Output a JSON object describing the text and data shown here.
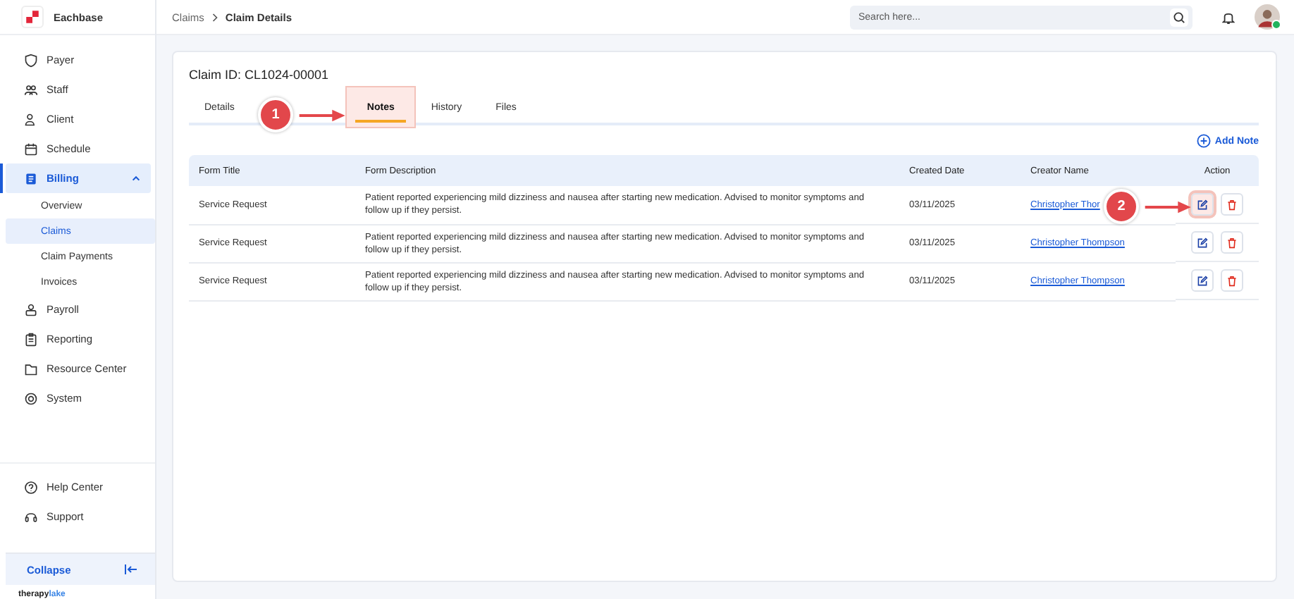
{
  "brand": {
    "name": "Eachbase"
  },
  "sidebar": {
    "items": [
      {
        "label": "Payer",
        "selected": false
      },
      {
        "label": "Staff",
        "selected": false
      },
      {
        "label": "Client",
        "selected": false
      },
      {
        "label": "Schedule",
        "selected": false
      },
      {
        "label": "Billing",
        "selected": true,
        "expanded": true,
        "children": [
          {
            "label": "Overview",
            "selected": false
          },
          {
            "label": "Claims",
            "selected": true
          },
          {
            "label": "Claim Payments",
            "selected": false
          },
          {
            "label": "Invoices",
            "selected": false
          }
        ]
      },
      {
        "label": "Payroll",
        "selected": false
      },
      {
        "label": "Reporting",
        "selected": false
      },
      {
        "label": "Resource Center",
        "selected": false
      },
      {
        "label": "System",
        "selected": false
      }
    ],
    "bottom_items": [
      {
        "label": "Help Center"
      },
      {
        "label": "Support"
      }
    ],
    "collapse": {
      "label": "Collapse"
    },
    "footer_logo": {
      "text": "therapy",
      "accent": "lake"
    }
  },
  "breadcrumb": [
    "Claims",
    "Claim Details"
  ],
  "search": {
    "placeholder": "Search here..."
  },
  "user": {
    "online": true
  },
  "claim": {
    "title": "Claim ID: CL1024-00001"
  },
  "tabs": [
    {
      "label": "Details",
      "selected": false,
      "highlighted": false
    },
    {
      "label": "Notes",
      "selected": true,
      "highlighted": true
    },
    {
      "label": "History",
      "selected": false,
      "highlighted": false
    },
    {
      "label": "Files",
      "selected": false,
      "highlighted": false
    }
  ],
  "add_note": {
    "label": "Add Note"
  },
  "table": {
    "columns": [
      "Form Title",
      "Form Description",
      "Created Date",
      "Creator Name",
      "Action"
    ],
    "rows": [
      {
        "title": "Service Request",
        "description": "Patient reported experiencing mild dizziness and nausea after starting new medication. Advised to monitor symptoms and follow up if they persist.",
        "date": "03/11/2025",
        "creator": "Christopher Thor",
        "edit_highlighted": true
      },
      {
        "title": "Service Request",
        "description": "Patient reported experiencing mild dizziness and nausea after starting new medication. Advised to monitor symptoms and follow up if they persist.",
        "date": "03/11/2025",
        "creator": "Christopher Thompson",
        "edit_highlighted": false
      },
      {
        "title": "Service Request",
        "description": "Patient reported experiencing mild dizziness and nausea after starting new medication. Advised to monitor symptoms and follow up if they persist.",
        "date": "03/11/2025",
        "creator": "Christopher Thompson",
        "edit_highlighted": false
      }
    ]
  },
  "callouts": [
    {
      "number": "1"
    },
    {
      "number": "2"
    }
  ]
}
